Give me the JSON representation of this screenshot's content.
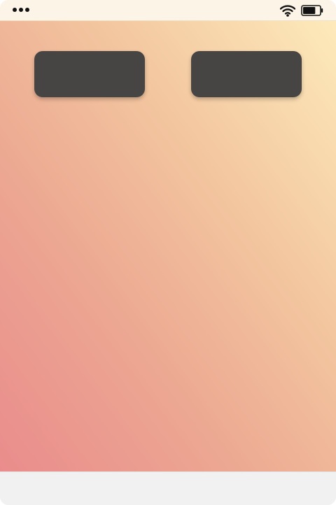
{
  "status_bar": {
    "signal_icon": "three-dots-signal-icon",
    "wifi_icon": "wifi-icon",
    "battery_icon": "battery-icon",
    "battery_level": 0.75
  },
  "wallpaper": {
    "gradient_colors": [
      "#ea8c8c",
      "#eca892",
      "#f3c69f",
      "#fdeabb"
    ]
  },
  "widgets": [
    {
      "label": "",
      "color": "#474444"
    },
    {
      "label": "",
      "color": "#474444"
    }
  ],
  "bottom_bar": {
    "color": "#f1f1f1"
  }
}
